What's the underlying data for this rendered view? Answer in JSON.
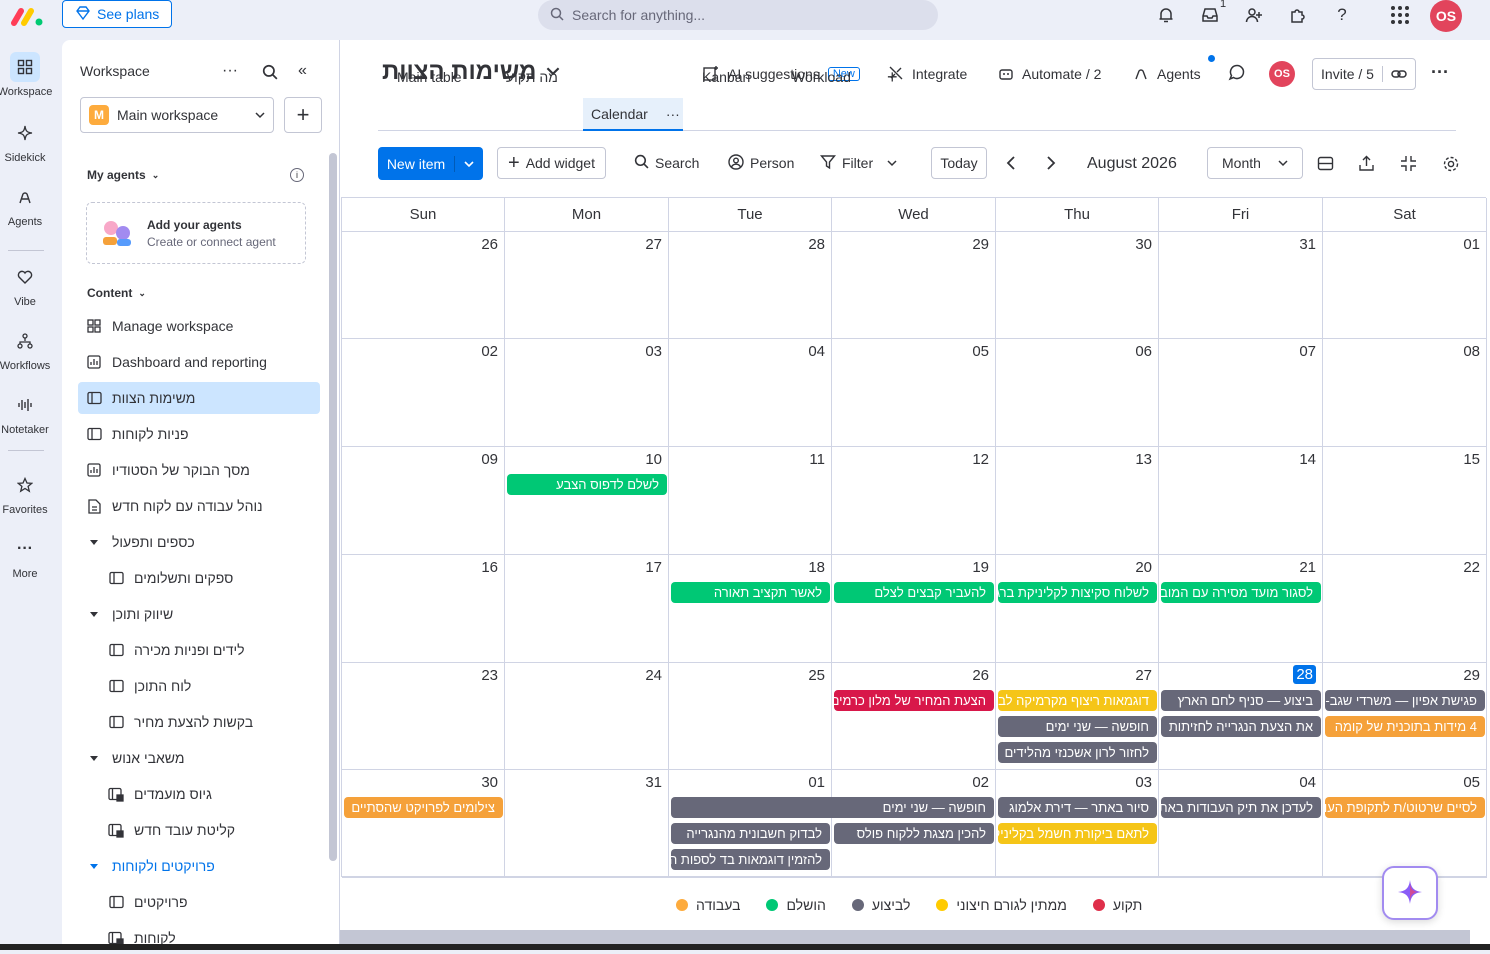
{
  "topbar": {
    "see_plans": "See plans",
    "search_placeholder": "Search for anything...",
    "inbox_count": "1",
    "avatar": "OS"
  },
  "rail": [
    {
      "label": "Workspace",
      "icon": "grid-icon"
    },
    {
      "label": "Sidekick",
      "icon": "sparkle-icon"
    },
    {
      "label": "Agents",
      "icon": "agent-icon"
    },
    {
      "label": "Vibe",
      "icon": "heart-icon"
    },
    {
      "label": "Workflows",
      "icon": "workflow-icon"
    },
    {
      "label": "Notetaker",
      "icon": "waveform-icon"
    },
    {
      "label": "Favorites",
      "icon": "star-icon"
    },
    {
      "label": "More",
      "icon": "more-icon"
    }
  ],
  "sidebar": {
    "title": "Workspace",
    "workspace": "Main workspace",
    "workspace_letter": "M",
    "my_agents": "My agents",
    "add_agents_title": "Add your agents",
    "add_agents_sub": "Create or connect agent",
    "content": "Content",
    "items": [
      {
        "label": "Manage workspace",
        "icon": "manage-icon",
        "indent": 0,
        "sel": false
      },
      {
        "label": "Dashboard and reporting",
        "icon": "dashboard-icon",
        "indent": 0,
        "sel": false
      },
      {
        "label": "משימות הצוות",
        "icon": "board-icon",
        "indent": 0,
        "sel": true
      },
      {
        "label": "פניות לקוחות",
        "icon": "board-icon",
        "indent": 0,
        "sel": false
      },
      {
        "label": "מסך הבוקר של הסטודיו",
        "icon": "dashboard-icon",
        "indent": 0,
        "sel": false
      },
      {
        "label": "נוהל עבודה עם לקוח חדש",
        "icon": "doc-icon",
        "indent": 0,
        "sel": false
      },
      {
        "label": "כספים ותפעול",
        "icon": "folder-caret",
        "indent": 0,
        "sel": false
      },
      {
        "label": "ספקים ותשלומים",
        "icon": "board-icon",
        "indent": 1,
        "sel": false
      },
      {
        "label": "שיווק ותוכן",
        "icon": "folder-caret",
        "indent": 0,
        "sel": false
      },
      {
        "label": "לידים ופניות מכירה",
        "icon": "board-icon",
        "indent": 1,
        "sel": false
      },
      {
        "label": "לוח התוכן",
        "icon": "board-icon",
        "indent": 1,
        "sel": false
      },
      {
        "label": "בקשות להצעת מחיר",
        "icon": "board-icon",
        "indent": 1,
        "sel": false
      },
      {
        "label": "משאבי אנוש",
        "icon": "folder-caret",
        "indent": 0,
        "sel": false
      },
      {
        "label": "גיוס מועמדים",
        "icon": "lock-board-icon",
        "indent": 1,
        "sel": false
      },
      {
        "label": "קליטת עובד חדש",
        "icon": "lock-board-icon",
        "indent": 1,
        "sel": false
      },
      {
        "label": "פרויקטים ולקוחות",
        "icon": "folder-caret",
        "indent": 0,
        "sel": false,
        "accent": true
      },
      {
        "label": "פרויקטים",
        "icon": "board-icon",
        "indent": 1,
        "sel": false
      },
      {
        "label": "לקוחות",
        "icon": "lock-board-icon",
        "indent": 1,
        "sel": false
      }
    ]
  },
  "board": {
    "title": "משימות הצוות",
    "ai_suggestions": "AI suggestions",
    "new_badge": "New",
    "integrate": "Integrate",
    "automate": "Automate / 2",
    "agents": "Agents",
    "invite": "Invite / 5",
    "tabs": [
      "Main table",
      "מה תקוע",
      "Calendar",
      "Kanban",
      "Workload"
    ],
    "active_tab": "Calendar",
    "new_item": "New item",
    "add_widget": "Add widget",
    "search": "Search",
    "person": "Person",
    "filter": "Filter",
    "today": "Today",
    "month_label": "August 2026",
    "view": "Month"
  },
  "calendar": {
    "weekdays": [
      "Sun",
      "Mon",
      "Tue",
      "Wed",
      "Thu",
      "Fri",
      "Sat"
    ],
    "weeks": [
      [
        "26",
        "27",
        "28",
        "29",
        "30",
        "31",
        "01"
      ],
      [
        "02",
        "03",
        "04",
        "05",
        "06",
        "07",
        "08"
      ],
      [
        "09",
        "10",
        "11",
        "12",
        "13",
        "14",
        "15"
      ],
      [
        "16",
        "17",
        "18",
        "19",
        "20",
        "21",
        "22"
      ],
      [
        "23",
        "24",
        "25",
        "26",
        "27",
        "28",
        "29"
      ],
      [
        "30",
        "31",
        "01",
        "02",
        "03",
        "04",
        "05"
      ]
    ],
    "today": {
      "week": 4,
      "day": 5
    },
    "events": [
      {
        "week": 2,
        "day": 1,
        "span": 1,
        "row": 0,
        "text": "לשלם לדפוס הצבע",
        "status": "done"
      },
      {
        "week": 3,
        "day": 2,
        "span": 1,
        "row": 0,
        "text": "לאשר תקציב תאורה",
        "status": "done"
      },
      {
        "week": 3,
        "day": 3,
        "span": 1,
        "row": 0,
        "text": "להעביר קבצים לצלם",
        "status": "done"
      },
      {
        "week": 3,
        "day": 4,
        "span": 1,
        "row": 0,
        "text": "לשלוח סקיצות לקליניקת ברגע",
        "status": "done"
      },
      {
        "week": 3,
        "day": 5,
        "span": 1,
        "row": 0,
        "text": "לסגור מועד מסירה עם המוביל",
        "status": "done"
      },
      {
        "week": 4,
        "day": 3,
        "span": 1,
        "row": 0,
        "text": "הצעת המחיר של מלון כרמים",
        "status": "stuck"
      },
      {
        "week": 4,
        "day": 4,
        "span": 1,
        "row": 0,
        "text": "דוגמאות ריצוף מקרמיקה לבנה",
        "status": "external"
      },
      {
        "week": 4,
        "day": 5,
        "span": 1,
        "row": 0,
        "text": "ביצוע — סניף לחם הארץ",
        "status": "doing"
      },
      {
        "week": 4,
        "day": 6,
        "span": 1,
        "row": 0,
        "text": "פגישת אפיון — משרדי שגב-לוי",
        "status": "doing"
      },
      {
        "week": 4,
        "day": 4,
        "span": 1,
        "row": 1,
        "text": "חופשה — שני ימים",
        "status": "doing"
      },
      {
        "week": 4,
        "day": 5,
        "span": 1,
        "row": 1,
        "text": "את הצעת הנגרייה לחזיתות",
        "status": "doing"
      },
      {
        "week": 4,
        "day": 6,
        "span": 1,
        "row": 1,
        "text": "4 מידות בתוכנית של קומה",
        "status": "working"
      },
      {
        "week": 4,
        "day": 4,
        "span": 1,
        "row": 2,
        "text": "לחזור לרון אשכנזי מהלידים",
        "status": "doing"
      },
      {
        "week": 5,
        "day": 0,
        "span": 1,
        "row": 0,
        "text": "צילומים לפרויקט שהסתיים",
        "status": "working"
      },
      {
        "week": 5,
        "day": 2,
        "span": 2,
        "row": 0,
        "text": "חופשה — שני ימים",
        "status": "doing"
      },
      {
        "week": 5,
        "day": 4,
        "span": 1,
        "row": 0,
        "text": "סיור באתר — דירת אלמוג",
        "status": "doing"
      },
      {
        "week": 5,
        "day": 5,
        "span": 1,
        "row": 0,
        "text": "לעדכן את תיק העבודות באתר",
        "status": "doing"
      },
      {
        "week": 5,
        "day": 6,
        "span": 1,
        "row": 0,
        "text": "לסיים שרטוט/ת לתקופת העומס",
        "status": "working"
      },
      {
        "week": 5,
        "day": 2,
        "span": 1,
        "row": 1,
        "text": "לבדוק חשבונית מהנגרייה",
        "status": "doing"
      },
      {
        "week": 5,
        "day": 3,
        "span": 1,
        "row": 1,
        "text": "להכין מצגת ללקוח פולס",
        "status": "doing"
      },
      {
        "week": 5,
        "day": 4,
        "span": 1,
        "row": 1,
        "text": "לתאם ביקורת חשמל בקליניקה",
        "status": "external"
      },
      {
        "week": 5,
        "day": 2,
        "span": 1,
        "row": 2,
        "text": "להזמין דוגמאות בד לספות הלובי",
        "status": "doing"
      }
    ]
  },
  "legend": [
    {
      "label": "בעבודה",
      "color": "#fdab3d"
    },
    {
      "label": "הושלם",
      "color": "#00c875"
    },
    {
      "label": "לביצוע",
      "color": "#676879"
    },
    {
      "label": "ממתין לגורם חיצוני",
      "color": "#ffcb00"
    },
    {
      "label": "תקוע",
      "color": "#df2f4a"
    }
  ],
  "colors": {
    "done": "#00c875",
    "stuck": "#d8174a",
    "external": "#f5c518",
    "doing": "#676879",
    "working": "#f5a13a",
    "accent": "#0073ea"
  }
}
